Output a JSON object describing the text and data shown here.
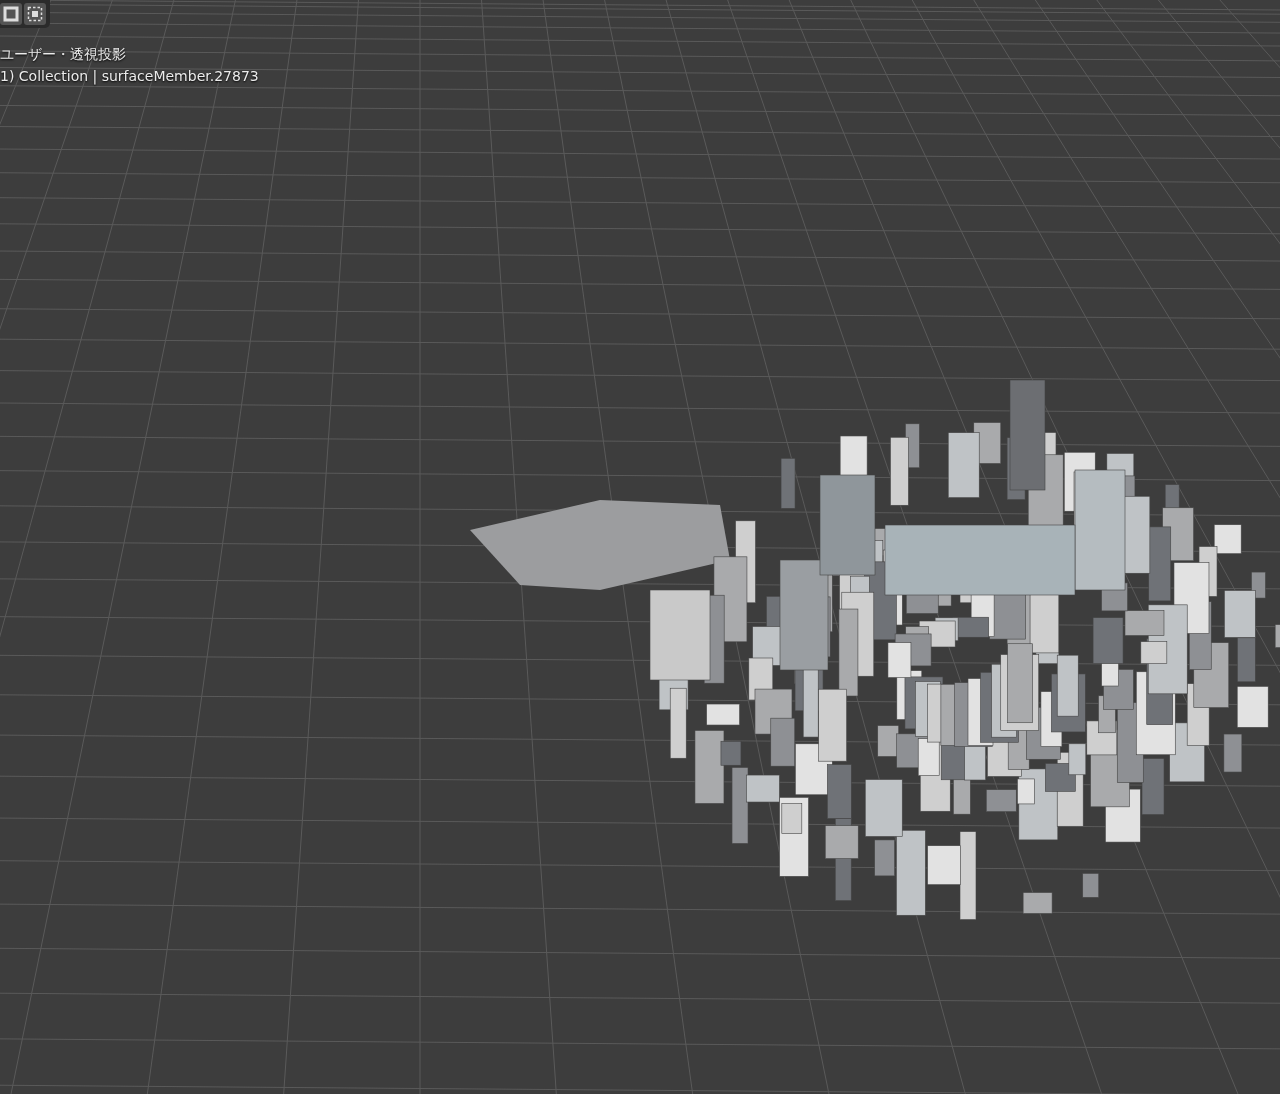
{
  "toolbar": {
    "buttons": [
      {
        "kind": "select-object"
      },
      {
        "kind": "select-box"
      }
    ]
  },
  "viewport": {
    "view_name": "ユーザー・透視投影",
    "object_info": "1) Collection | surfaceMember.27873"
  }
}
